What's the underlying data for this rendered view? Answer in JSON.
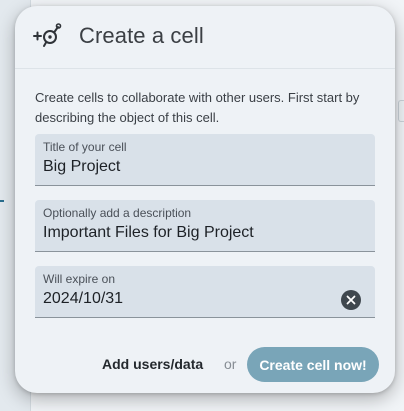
{
  "dialog": {
    "title": "Create a cell",
    "icon": "add-cell-icon",
    "intro": "Create cells to collaborate with other users. First start by describing the object of this cell."
  },
  "fields": {
    "title": {
      "label": "Title of your cell",
      "value": "Big Project"
    },
    "description": {
      "label": "Optionally add a description",
      "value": "Important Files for Big Project"
    },
    "expiry": {
      "label": "Will expire on",
      "value": "2024/10/31",
      "clear_icon": "clear-circle-icon"
    }
  },
  "actions": {
    "add_users_label": "Add users/data",
    "or_label": "or",
    "create_label": "Create cell now!"
  },
  "colors": {
    "primary": "#79a5b8",
    "field_bg": "#d9e1e9",
    "dialog_bg": "#eef2f6"
  }
}
